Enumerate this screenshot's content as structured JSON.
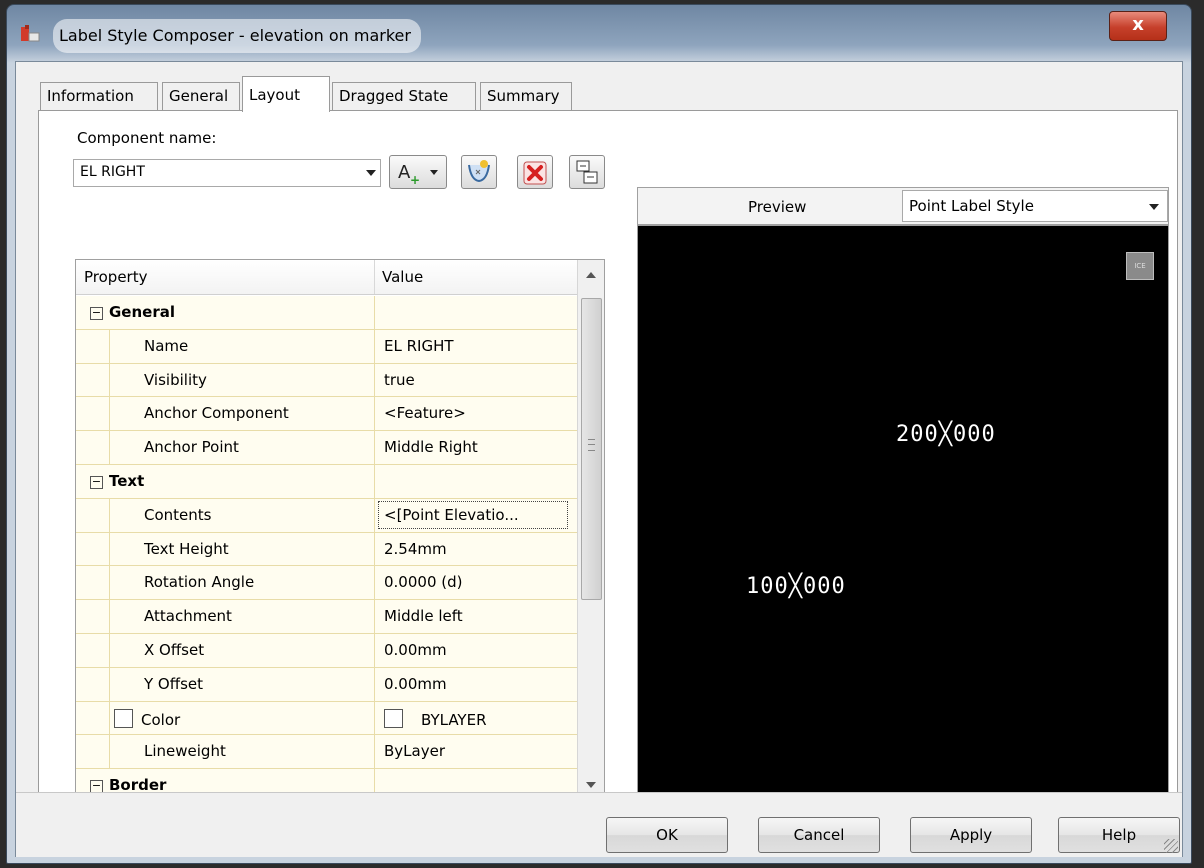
{
  "window": {
    "title": "Label Style Composer - elevation on marker",
    "close_glyph": "x"
  },
  "tabs": [
    {
      "label": "Information",
      "active": false
    },
    {
      "label": "General",
      "active": false
    },
    {
      "label": "Layout",
      "active": true
    },
    {
      "label": "Dragged State",
      "active": false
    },
    {
      "label": "Summary",
      "active": false
    }
  ],
  "component": {
    "label": "Component name:",
    "value": "EL RIGHT"
  },
  "toolbar": {
    "add_text_label": "A",
    "icons": [
      "add-component-icon",
      "copy-component-icon",
      "delete-component-icon",
      "draw-order-icon"
    ]
  },
  "grid": {
    "headers": {
      "property": "Property",
      "value": "Value"
    },
    "rows": [
      {
        "type": "category",
        "expander": "⊟",
        "label": "General"
      },
      {
        "type": "prop",
        "label": "Name",
        "value": "EL RIGHT"
      },
      {
        "type": "prop",
        "label": "Visibility",
        "value": "true"
      },
      {
        "type": "prop",
        "label": "Anchor Component",
        "value": "<Feature>"
      },
      {
        "type": "prop",
        "label": "Anchor Point",
        "value": "Middle Right"
      },
      {
        "type": "category",
        "expander": "⊟",
        "label": "Text"
      },
      {
        "type": "prop",
        "label": "Contents",
        "value": "<[Point Elevatio..."
      },
      {
        "type": "prop",
        "label": "Text Height",
        "value": "2.54mm"
      },
      {
        "type": "prop",
        "label": "Rotation Angle",
        "value": "0.0000 (d)"
      },
      {
        "type": "prop",
        "label": "Attachment",
        "value": "Middle left"
      },
      {
        "type": "prop",
        "label": "X Offset",
        "value": "0.00mm"
      },
      {
        "type": "prop",
        "label": "Y Offset",
        "value": "0.00mm"
      },
      {
        "type": "prop",
        "label": "Color",
        "value": "BYLAYER"
      },
      {
        "type": "prop",
        "label": "Lineweight",
        "value": "ByLayer"
      },
      {
        "type": "category",
        "expander": "⊟",
        "label": "Border"
      }
    ]
  },
  "preview": {
    "label": "Preview",
    "style_value": "Point Label Style",
    "labels": [
      "200╳000",
      "100╳000"
    ]
  },
  "buttons": {
    "ok": "OK",
    "cancel": "Cancel",
    "apply": "Apply",
    "help": "Help"
  },
  "colors": {
    "canvas_bg": "#000000",
    "grid_row_bg": "#fffdf0",
    "delete_red": "#d62020"
  }
}
